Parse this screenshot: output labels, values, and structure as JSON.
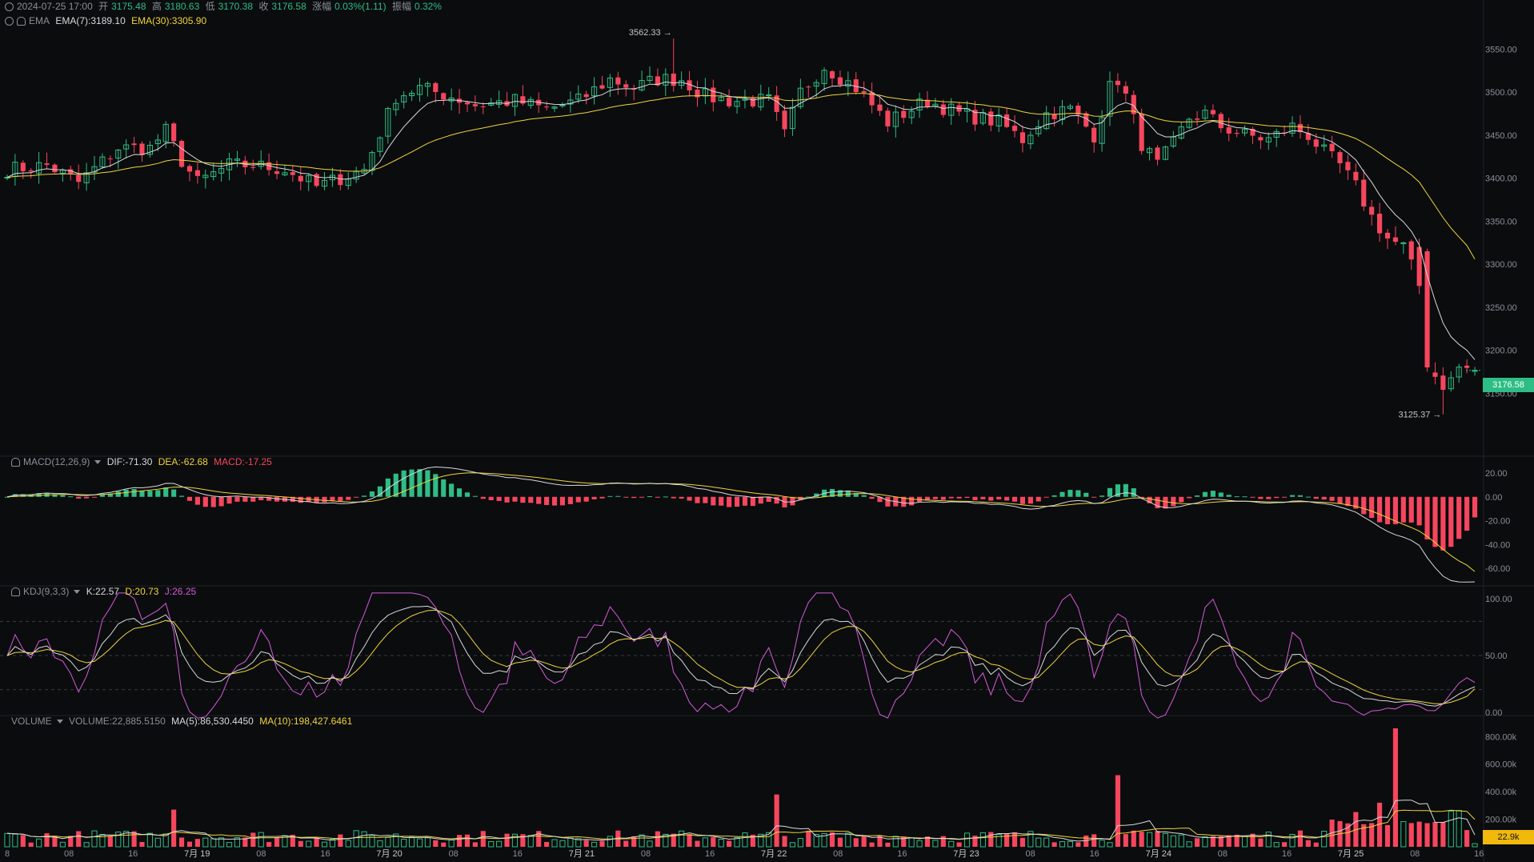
{
  "header": {
    "datetime": "2024-07-25 17:00",
    "open_label": "开",
    "open": "3175.48",
    "high_label": "高",
    "high": "3180.63",
    "low_label": "低",
    "low": "3170.38",
    "close_label": "收",
    "close": "3176.58",
    "change_label": "涨幅",
    "change": "0.03%(1.11)",
    "amp_label": "振幅",
    "amp": "0.32%"
  },
  "ema": {
    "name": "EMA",
    "ema7": "EMA(7):3189.10",
    "ema30": "EMA(30):3305.90"
  },
  "macd": {
    "name": "MACD(12,26,9)",
    "dif": "DIF:-71.30",
    "dea": "DEA:-62.68",
    "macd": "MACD:-17.25"
  },
  "kdj": {
    "name": "KDJ(9,3,3)",
    "k": "K:22.57",
    "d": "D:20.73",
    "j": "J:26.25"
  },
  "volume": {
    "name": "VOLUME",
    "vol": "VOLUME:22,885.5150",
    "ma5": "MA(5):86,530.4450",
    "ma10": "MA(10):198,427.6461"
  },
  "price_tag": "3176.58",
  "volume_tag": "22.9k",
  "annotations": {
    "high": "3562.33 →",
    "low": "3125.37 →"
  },
  "colors": {
    "up": "#2ebd85",
    "down": "#f6465d",
    "ema7": "#d6d9dc",
    "ema30": "#f0d43a",
    "kdj_j": "#d45bd8",
    "background": "#0b0c0e"
  },
  "chart_data": [
    {
      "type": "candlestick",
      "title": "",
      "y_ticks": [
        "3550.00",
        "3500.00",
        "3450.00",
        "3400.00",
        "3350.00",
        "3300.00",
        "3250.00",
        "3200.00",
        "3150.00"
      ],
      "ylim": [
        3100,
        3570
      ],
      "x_ticks": [
        "8",
        "08",
        "16",
        "7月 19",
        "08",
        "16",
        "7月 20",
        "08",
        "16",
        "7月 21",
        "08",
        "16",
        "7月 22",
        "08",
        "16",
        "7月 23",
        "08",
        "16",
        "7月 24",
        "08",
        "16",
        "7月 25",
        "08",
        "16"
      ],
      "candle_count": 186,
      "last": {
        "open": 3175.48,
        "high": 3180.63,
        "low": 3170.38,
        "close": 3176.58
      },
      "max_marker": 3562.33,
      "min_marker": 3125.37,
      "close_anchors": [
        [
          0,
          3410
        ],
        [
          5,
          3415
        ],
        [
          9,
          3395
        ],
        [
          14,
          3435
        ],
        [
          18,
          3435
        ],
        [
          20,
          3455
        ],
        [
          22,
          3420
        ],
        [
          24,
          3395
        ],
        [
          28,
          3415
        ],
        [
          31,
          3415
        ],
        [
          35,
          3410
        ],
        [
          39,
          3390
        ],
        [
          42,
          3400
        ],
        [
          45,
          3410
        ],
        [
          49,
          3495
        ],
        [
          52,
          3505
        ],
        [
          56,
          3495
        ],
        [
          59,
          3485
        ],
        [
          64,
          3490
        ],
        [
          68,
          3480
        ],
        [
          72,
          3490
        ],
        [
          76,
          3515
        ],
        [
          79,
          3505
        ],
        [
          82,
          3515
        ],
        [
          85,
          3515
        ],
        [
          88,
          3495
        ],
        [
          91,
          3490
        ],
        [
          96,
          3490
        ],
        [
          98,
          3450
        ],
        [
          100,
          3500
        ],
        [
          103,
          3530
        ],
        [
          107,
          3505
        ],
        [
          111,
          3465
        ],
        [
          116,
          3490
        ],
        [
          120,
          3475
        ],
        [
          125,
          3465
        ],
        [
          128,
          3445
        ],
        [
          131,
          3475
        ],
        [
          134,
          3480
        ],
        [
          137,
          3450
        ],
        [
          139,
          3505
        ],
        [
          140,
          3515
        ],
        [
          141,
          3495
        ],
        [
          143,
          3440
        ],
        [
          145,
          3415
        ],
        [
          147,
          3440
        ],
        [
          149,
          3470
        ],
        [
          151,
          3475
        ],
        [
          153,
          3460
        ],
        [
          156,
          3450
        ],
        [
          159,
          3445
        ],
        [
          162,
          3460
        ],
        [
          164,
          3450
        ],
        [
          166,
          3430
        ],
        [
          168,
          3415
        ],
        [
          170,
          3390
        ],
        [
          172,
          3355
        ],
        [
          174,
          3330
        ],
        [
          176,
          3320
        ],
        [
          178,
          3275
        ],
        [
          179,
          3180
        ],
        [
          181,
          3160
        ],
        [
          182,
          3165
        ],
        [
          183,
          3180
        ],
        [
          185,
          3176.58
        ]
      ],
      "series": [
        {
          "name": "EMA(7)",
          "last": 3189.1
        },
        {
          "name": "EMA(30)",
          "last": 3305.9
        }
      ]
    },
    {
      "type": "bar",
      "title": "MACD(12,26,9)",
      "y_ticks": [
        "20.00",
        "0.00",
        "-20.00",
        "-40.00",
        "-60.00"
      ],
      "ylim": [
        -72,
        24
      ],
      "series": [
        {
          "name": "DIF",
          "last": -71.3
        },
        {
          "name": "DEA",
          "last": -62.68
        },
        {
          "name": "MACD",
          "last": -17.25
        }
      ]
    },
    {
      "type": "line",
      "title": "KDJ(9,3,3)",
      "y_ticks": [
        "100.00",
        "50.00",
        "0.00"
      ],
      "ylim": [
        0,
        100
      ],
      "series": [
        {
          "name": "K",
          "last": 22.57
        },
        {
          "name": "D",
          "last": 20.73
        },
        {
          "name": "J",
          "last": 26.25
        }
      ]
    },
    {
      "type": "bar",
      "title": "VOLUME",
      "y_ticks": [
        "800.00k",
        "600.00k",
        "400.00k",
        "200.00k"
      ],
      "ylim": [
        0,
        860000
      ],
      "last": 22885.515,
      "spikes": [
        [
          21,
          270000
        ],
        [
          97,
          380000
        ],
        [
          140,
          520000
        ],
        [
          175,
          860000
        ],
        [
          173,
          320000
        ]
      ],
      "series": [
        {
          "name": "MA(5)",
          "last": 86530.445
        },
        {
          "name": "MA(10)",
          "last": 198427.6461
        }
      ]
    }
  ]
}
